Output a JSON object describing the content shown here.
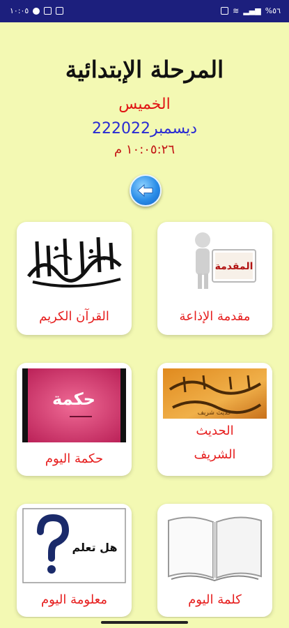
{
  "status_bar": {
    "time": "١٠:٠٥",
    "battery": "%٥٦"
  },
  "header": {
    "title": "المرحلة الإبتدائية",
    "day": "الخميس",
    "date": "22ديسمبر2022",
    "time": "١٠:٠٥:٢٦ م"
  },
  "cards": [
    {
      "label": "مقدمة الإذاعة",
      "image_text": "المقدمة",
      "icon": "presenter-board-icon"
    },
    {
      "label": "القرآن الكريم",
      "image_text": "القرآن الكريم",
      "icon": "quran-calligraphy-icon"
    },
    {
      "label_line1": "الحديث",
      "label_line2": "الشريف",
      "image_text": "حديث شريف",
      "icon": "hadith-calligraphy-icon"
    },
    {
      "label": "حكمة اليوم",
      "image_text": "حكمة",
      "icon": "wisdom-banner-icon"
    },
    {
      "label": "كلمة اليوم",
      "icon": "open-book-icon"
    },
    {
      "label": "معلومة اليوم",
      "image_text": "هل تعلم",
      "icon": "question-mark-icon"
    }
  ],
  "colors": {
    "background": "#f3f9b3",
    "status_bar": "#1c1f7d",
    "label_red": "#e61e1e",
    "date_blue": "#2a2bd2"
  }
}
